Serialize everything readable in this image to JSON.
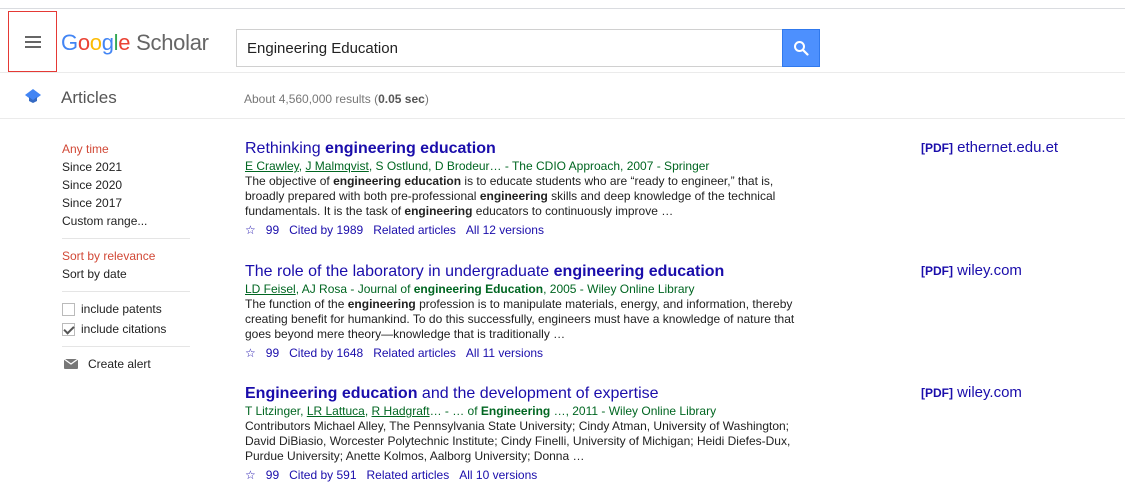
{
  "header": {
    "logo_google": [
      "G",
      "o",
      "o",
      "g",
      "l",
      "e"
    ],
    "logo_scholar": "Scholar",
    "search_value": "Engineering Education"
  },
  "subheader": {
    "section_label": "Articles",
    "results_prefix": "About 4,560,000 results (",
    "results_time": "0.05 sec",
    "results_suffix": ")"
  },
  "sidebar": {
    "time_filters": [
      "Any time",
      "Since 2021",
      "Since 2020",
      "Since 2017",
      "Custom range..."
    ],
    "sort_options": [
      "Sort by relevance",
      "Sort by date"
    ],
    "include_patents": "include patents",
    "include_citations": "include citations",
    "create_alert": "Create alert"
  },
  "results": [
    {
      "title_pre": "Rethinking ",
      "title_bold": "engineering education",
      "title_post": "",
      "authors_linked": [
        "E Crawley",
        "J Malmqvist"
      ],
      "authors_rest": ", S Ostlund, D Brodeur… - The CDIO Approach, 2007 - Springer",
      "snippet": [
        "The objective of ",
        "engineering education",
        " is to educate students who are “ready to engineer,” that is, broadly prepared with both pre-professional ",
        "engineering",
        " skills and deep knowledge of the technical fundamentals. It is the task of ",
        "engineering",
        " educators to continuously improve …"
      ],
      "cited_by": "Cited by 1989",
      "related": "Related articles",
      "versions": "All 12 versions",
      "pdf_tag": "[PDF]",
      "pdf_source": "ethernet.edu.et"
    },
    {
      "title_pre": "The role of the laboratory in undergraduate ",
      "title_bold": "engineering education",
      "title_post": "",
      "authors_linked": [
        "LD Feisel"
      ],
      "authors_rest": ", AJ Rosa - Journal of ",
      "authors_bold": "engineering Education",
      "authors_tail": ", 2005 - Wiley Online Library",
      "snippet": [
        "The function of the ",
        "engineering",
        " profession is to manipulate materials, energy, and information, thereby creating benefit for humankind. To do this successfully, engineers must have a knowledge of nature that goes beyond mere theory—knowledge that is traditionally …"
      ],
      "cited_by": "Cited by 1648",
      "related": "Related articles",
      "versions": "All 11 versions",
      "pdf_tag": "[PDF]",
      "pdf_source": "wiley.com"
    },
    {
      "title_pre": "",
      "title_bold": "Engineering education",
      "title_post": " and the development of expertise",
      "authors_pre": "T Litzinger, ",
      "authors_linked": [
        "LR Lattuca",
        "R Hadgraft"
      ],
      "authors_rest": "… - … of ",
      "authors_bold": "Engineering",
      "authors_tail": " …, 2011 - Wiley Online Library",
      "snippet_text": "Contributors Michael Alley, The Pennsylvania State University; Cindy Atman, University of Washington; David DiBiasio, Worcester Polytechnic Institute; Cindy Finelli, University of Michigan; Heidi Diefes-Dux, Purdue University; Anette Kolmos, Aalborg University; Donna …",
      "cited_by": "Cited by 591",
      "related": "Related articles",
      "versions": "All 10 versions",
      "pdf_tag": "[PDF]",
      "pdf_source": "wiley.com"
    }
  ],
  "icons": {
    "save": "star-icon",
    "cite": "quote-icon",
    "cite_glyph": "99"
  },
  "colors": {
    "link": "#1a0dab",
    "author": "#006621",
    "selected": "#d14836",
    "search_button": "#4d90fe"
  }
}
